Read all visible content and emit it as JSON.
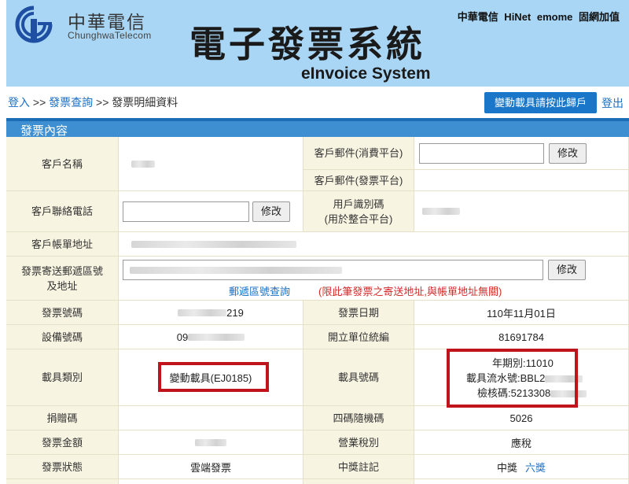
{
  "header": {
    "logo_cn": "中華電信",
    "logo_en": "ChunghwaTelecom",
    "top_links": "中華電信 HiNet emome 固網加值",
    "title": "電子發票系統",
    "subtitle": "eInvoice System"
  },
  "breadcrumb": {
    "login": "登入",
    "sep1": " >> ",
    "query": "發票查詢",
    "sep2": " >> ",
    "current": "發票明細資料"
  },
  "carrier_button": "變動載具請按此歸戶",
  "logout": "登出",
  "section_title": "發票內容",
  "form": {
    "edit_label": "修改",
    "customer_name_label": "客戶名稱",
    "email_consumer_label": "客戶郵件(消費平台)",
    "email_invoice_label": "客戶郵件(發票平台)",
    "phone_label": "客戶聯絡電話",
    "user_id_label_1": "用戶識別碼",
    "user_id_label_2": "(用於整合平台)",
    "billing_address_label": "客戶帳單地址",
    "mailing_label_1": "發票寄送郵遞區號",
    "mailing_label_2": "及地址",
    "postal_lookup": "郵遞區號查詢",
    "mailing_note": "(限此筆發票之寄送地址,與帳單地址無關)",
    "invoice_no_label": "發票號碼",
    "invoice_no_suffix": "219",
    "invoice_date_label": "發票日期",
    "invoice_date": "110年11月01日",
    "device_no_label": "設備號碼",
    "device_no_prefix": "09",
    "seller_id_label": "開立單位統編",
    "seller_id": "81691784",
    "carrier_type_label": "載具類別",
    "carrier_type": "變動載具(EJ0185)",
    "carrier_no_label": "載具號碼",
    "carrier_period": "年期別:11010",
    "carrier_serial": "載具流水號:BBL2",
    "carrier_check": "檢核碼:5213308",
    "donation_label": "捐贈碼",
    "random_code_label": "四碼隨機碼",
    "random_code": "5026",
    "amount_label": "發票金額",
    "tax_type_label": "營業稅別",
    "tax_type": "應稅",
    "status_label": "發票狀態",
    "status": "雲端發票",
    "winning_label": "中獎註記",
    "winning": "中獎",
    "prize": "六獎"
  },
  "colors": {
    "header_bg": "#a9d6f5",
    "section_bar": "#3d8fd1",
    "label_bg": "#f8f4e2",
    "highlight_red": "#c0141c",
    "link_blue": "#1a6fc4"
  }
}
